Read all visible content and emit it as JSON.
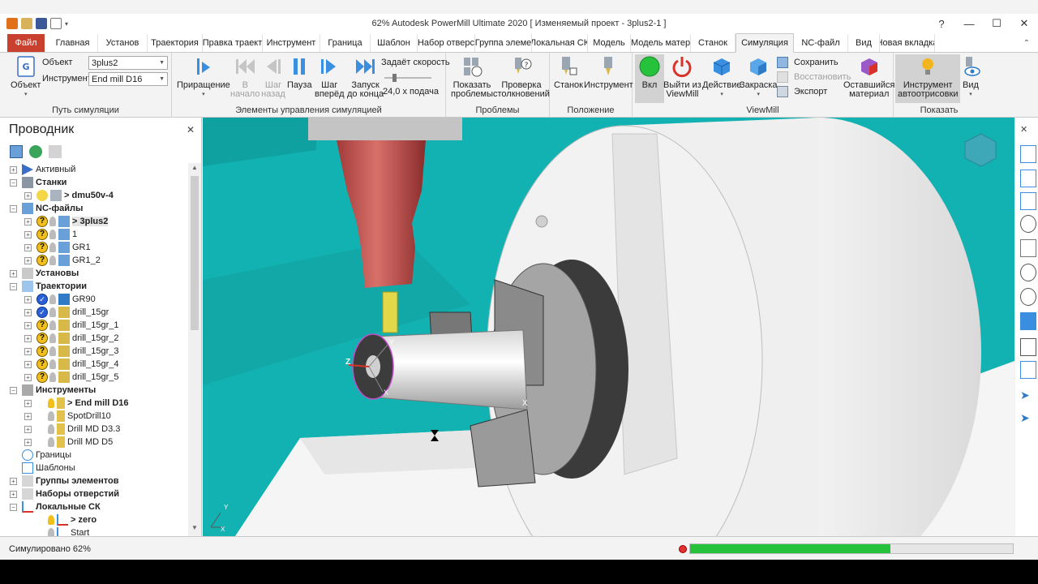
{
  "window": {
    "title": "62% Autodesk PowerMill Ultimate 2020  [ Изменяемый проект - 3plus2-1 ]"
  },
  "tabs": [
    {
      "label": "Файл"
    },
    {
      "label": "Главная"
    },
    {
      "label": "Установ"
    },
    {
      "label": "Траектория"
    },
    {
      "label": "Правка траект"
    },
    {
      "label": "Инструмент"
    },
    {
      "label": "Граница"
    },
    {
      "label": "Шаблон"
    },
    {
      "label": "Набор отверс"
    },
    {
      "label": "Группа элеме"
    },
    {
      "label": "Локальная СК"
    },
    {
      "label": "Модель"
    },
    {
      "label": "Модель матер"
    },
    {
      "label": "Станок"
    },
    {
      "label": "Симуляция"
    },
    {
      "label": "NC-файл"
    },
    {
      "label": "Вид"
    },
    {
      "label": "Новая вкладка"
    }
  ],
  "ribbon": {
    "sim_path": {
      "object_btn": "Объект",
      "object_label": "Объект",
      "object_value": "3plus2",
      "tool_label": "Инструмент",
      "tool_value": "End mill D16",
      "group_label": "Путь симуляции"
    },
    "sim_controls": {
      "increment": "Приращение",
      "to_start_1": "В",
      "to_start_2": "начало",
      "step_back_1": "Шаг",
      "step_back_2": "назад",
      "pause": "Пауза",
      "step_fwd_1": "Шаг",
      "step_fwd_2": "вперёд",
      "run_1": "Запуск",
      "run_2": "до конца",
      "speed_label": "Задаёт скорость",
      "speed_value": "24,0 x подача",
      "group_label": "Элементы управления симуляцией"
    },
    "problems": {
      "show_1": "Показать",
      "show_2": "проблемы",
      "check_1": "Проверка",
      "check_2": "столкновений",
      "group_label": "Проблемы"
    },
    "position": {
      "machine": "Станок",
      "tool": "Инструмент",
      "group_label": "Положение"
    },
    "viewmill": {
      "on": "Вкл",
      "exit_1": "Выйти из",
      "exit_2": "ViewMill",
      "action": "Действие",
      "shading": "Закраска",
      "save": "Сохранить",
      "restore": "Восстановить",
      "export": "Экспорт",
      "remaining_1": "Оставшийся",
      "remaining_2": "материал",
      "group_label": "ViewMill"
    },
    "show": {
      "tool_1": "Инструмент",
      "tool_2": "автоотрисовки",
      "view": "Вид",
      "group_label": "Показать"
    }
  },
  "explorer": {
    "title": "Проводник",
    "rows": [
      {
        "text": "Активный"
      },
      {
        "text": "Станки"
      },
      {
        "text": "> dmu50v-4"
      },
      {
        "text": "NC-файлы"
      },
      {
        "text": "> 3plus2"
      },
      {
        "text": "1"
      },
      {
        "text": "GR1"
      },
      {
        "text": "GR1_2"
      },
      {
        "text": "Установы"
      },
      {
        "text": "Траектории"
      },
      {
        "text": "GR90"
      },
      {
        "text": "drill_15gr"
      },
      {
        "text": "drill_15gr_1"
      },
      {
        "text": "drill_15gr_2"
      },
      {
        "text": "drill_15gr_3"
      },
      {
        "text": "drill_15gr_4"
      },
      {
        "text": "drill_15gr_5"
      },
      {
        "text": "Инструменты"
      },
      {
        "text": "> End mill D16"
      },
      {
        "text": "SpotDrill10"
      },
      {
        "text": "Drill MD D3.3"
      },
      {
        "text": "Drill MD D5"
      },
      {
        "text": "Границы"
      },
      {
        "text": "Шаблоны"
      },
      {
        "text": "Группы элементов"
      },
      {
        "text": "Наборы отверстий"
      },
      {
        "text": "Локальные СК"
      },
      {
        "text": "> zero"
      },
      {
        "text": "Start"
      }
    ]
  },
  "viewport": {
    "axis_z": "Z",
    "axis_y": "Y",
    "axis_x": "X",
    "axis_x2": "X",
    "triad_y": "Y",
    "triad_x": "X"
  },
  "status": {
    "text": "Симулировано 62%",
    "progress": 0.62
  },
  "colors": {
    "accent": "#c9402e",
    "viewport_bg": "#13b2b2",
    "progress": "#27c23c"
  }
}
